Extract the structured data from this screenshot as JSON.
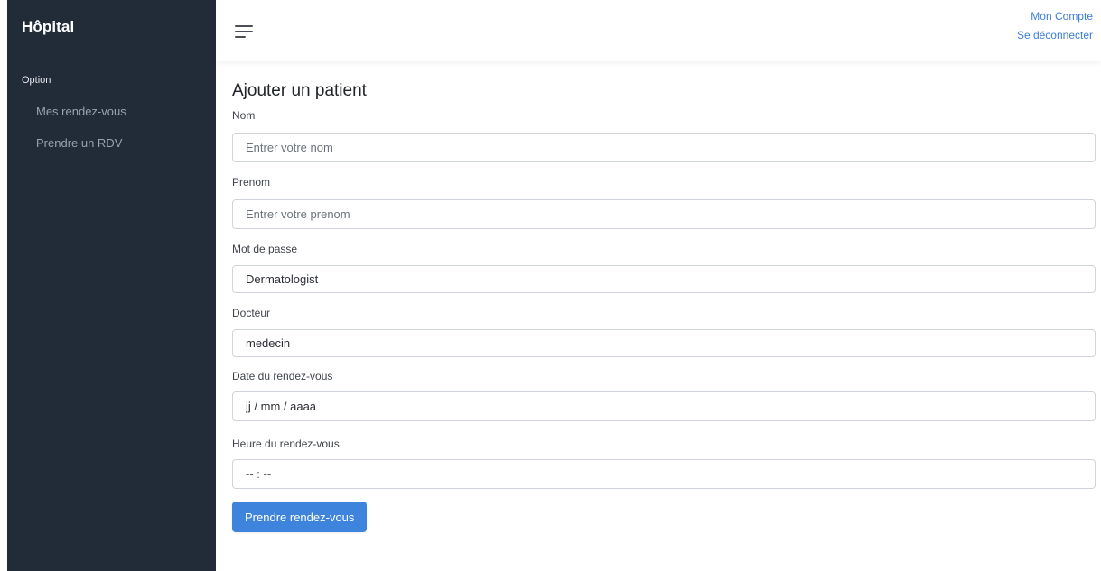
{
  "sidebar": {
    "brand": "Hôpital",
    "section": "Option",
    "items": [
      {
        "label": "Mes rendez-vous"
      },
      {
        "label": "Prendre un RDV"
      }
    ]
  },
  "header": {
    "menu_icon": "menu-icon",
    "account_link": "Mon Compte",
    "logout_link": "Se déconnecter"
  },
  "form": {
    "title": "Ajouter un patient",
    "fields": [
      {
        "label": "Nom",
        "placeholder": "Entrer votre nom",
        "value": ""
      },
      {
        "label": "Prenom",
        "placeholder": "Entrer votre prenom",
        "value": ""
      },
      {
        "label": "Mot de passe",
        "placeholder": "",
        "value": "Dermatologist"
      },
      {
        "label": "Docteur",
        "placeholder": "",
        "value": "medecin"
      },
      {
        "label": "Date du rendez-vous",
        "placeholder": "",
        "value": "jj / mm / aaaa"
      },
      {
        "label": "Heure du rendez-vous",
        "placeholder": "",
        "value": "-- : --"
      }
    ],
    "submit_label": "Prendre rendez-vous"
  },
  "colors": {
    "sidebar_bg": "#222b38",
    "accent": "#3f84dc",
    "link": "#3d7fd6"
  }
}
